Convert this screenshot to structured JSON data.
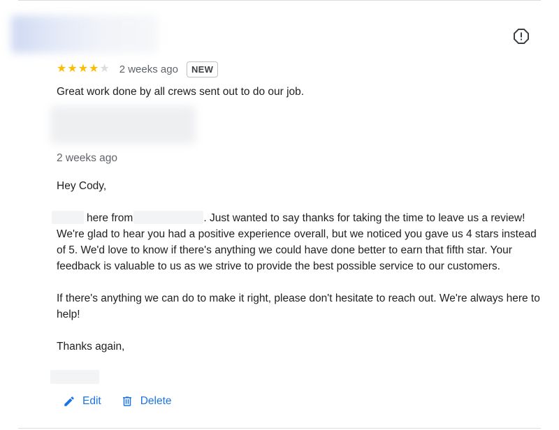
{
  "review": {
    "rating": 4,
    "max_rating": 5,
    "age": "2 weeks ago",
    "badge": "NEW",
    "text": "Great work done by all crews sent out to do our job."
  },
  "reply": {
    "age": "2 weeks ago",
    "greeting": "Hey Cody,",
    "p1_part1": "here from",
    "p1_part2": ". Just wanted to say thanks for taking the time to leave us a review! We're glad to hear you had a positive experience overall, but we noticed you gave us 4 stars instead of 5. We'd love to know if there's anything we could have done better to earn that fifth star. Your feedback is valuable to us as we strive to provide the best possible service to our customers.",
    "p2": "If there's anything we can do to make it right, please don't hesitate to reach out. We're always here to help!",
    "closing": "Thanks again,"
  },
  "actions": {
    "edit_label": "Edit",
    "delete_label": "Delete"
  },
  "icons": {
    "report": "report-icon",
    "edit": "pencil-icon",
    "delete": "trash-icon",
    "star": "star-icon"
  },
  "colors": {
    "star_filled": "#fbbc04",
    "star_empty": "#dadce0",
    "action_blue": "#1a73e8",
    "secondary_text": "#5f6368"
  }
}
